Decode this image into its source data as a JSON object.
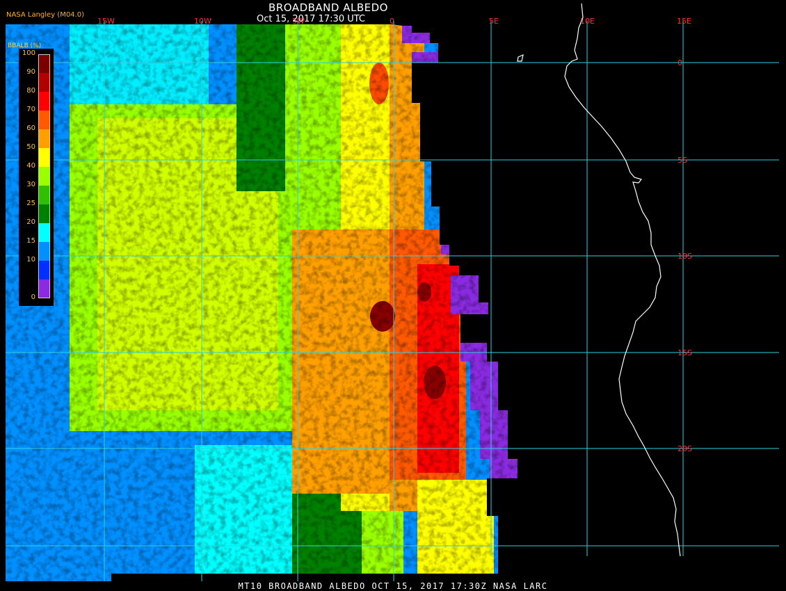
{
  "header": {
    "title": "BROADBAND ALBEDO",
    "datetime": "Oct 15, 2017 17:30 UTC",
    "producer": "NASA Langley (M04.0)"
  },
  "footer": {
    "caption": "MT10  BROADBAND ALBEDO   OCT 15, 2017 17:30Z   NASA LARC"
  },
  "colorbar": {
    "label": "BBALB (%)",
    "tick_labels": [
      "100",
      "90",
      "80",
      "70",
      "60",
      "50",
      "40",
      "30",
      "25",
      "20",
      "15",
      "10",
      "0"
    ],
    "colors": [
      "#7a0000",
      "#b00000",
      "#ff0000",
      "#ff5a00",
      "#ffa000",
      "#ffff00",
      "#9aff00",
      "#30c000",
      "#008000",
      "#00ffff",
      "#0090ff",
      "#0030ff",
      "#8a2be2"
    ]
  },
  "grid": {
    "line_color": "#30d0e0",
    "longitudes": [
      "15W",
      "10W",
      "5W",
      "0",
      "5E",
      "10E",
      "15E"
    ],
    "latitudes": [
      "0",
      "5S",
      "10S",
      "15S",
      "20S"
    ]
  },
  "map": {
    "background": "#000000",
    "coastline_color": "#ffffff",
    "swath_regions": [
      {
        "band": "cyan",
        "color": "#00ffff"
      },
      {
        "band": "blue",
        "color": "#0090ff"
      },
      {
        "band": "green",
        "color": "#008000"
      },
      {
        "band": "lightgreen",
        "color": "#9aff00"
      },
      {
        "band": "yellow",
        "color": "#ffff00"
      },
      {
        "band": "orange",
        "color": "#ffa000"
      },
      {
        "band": "red",
        "color": "#ff0000"
      },
      {
        "band": "darkred",
        "color": "#8a0000"
      },
      {
        "band": "purple",
        "color": "#8a2be2"
      }
    ]
  }
}
